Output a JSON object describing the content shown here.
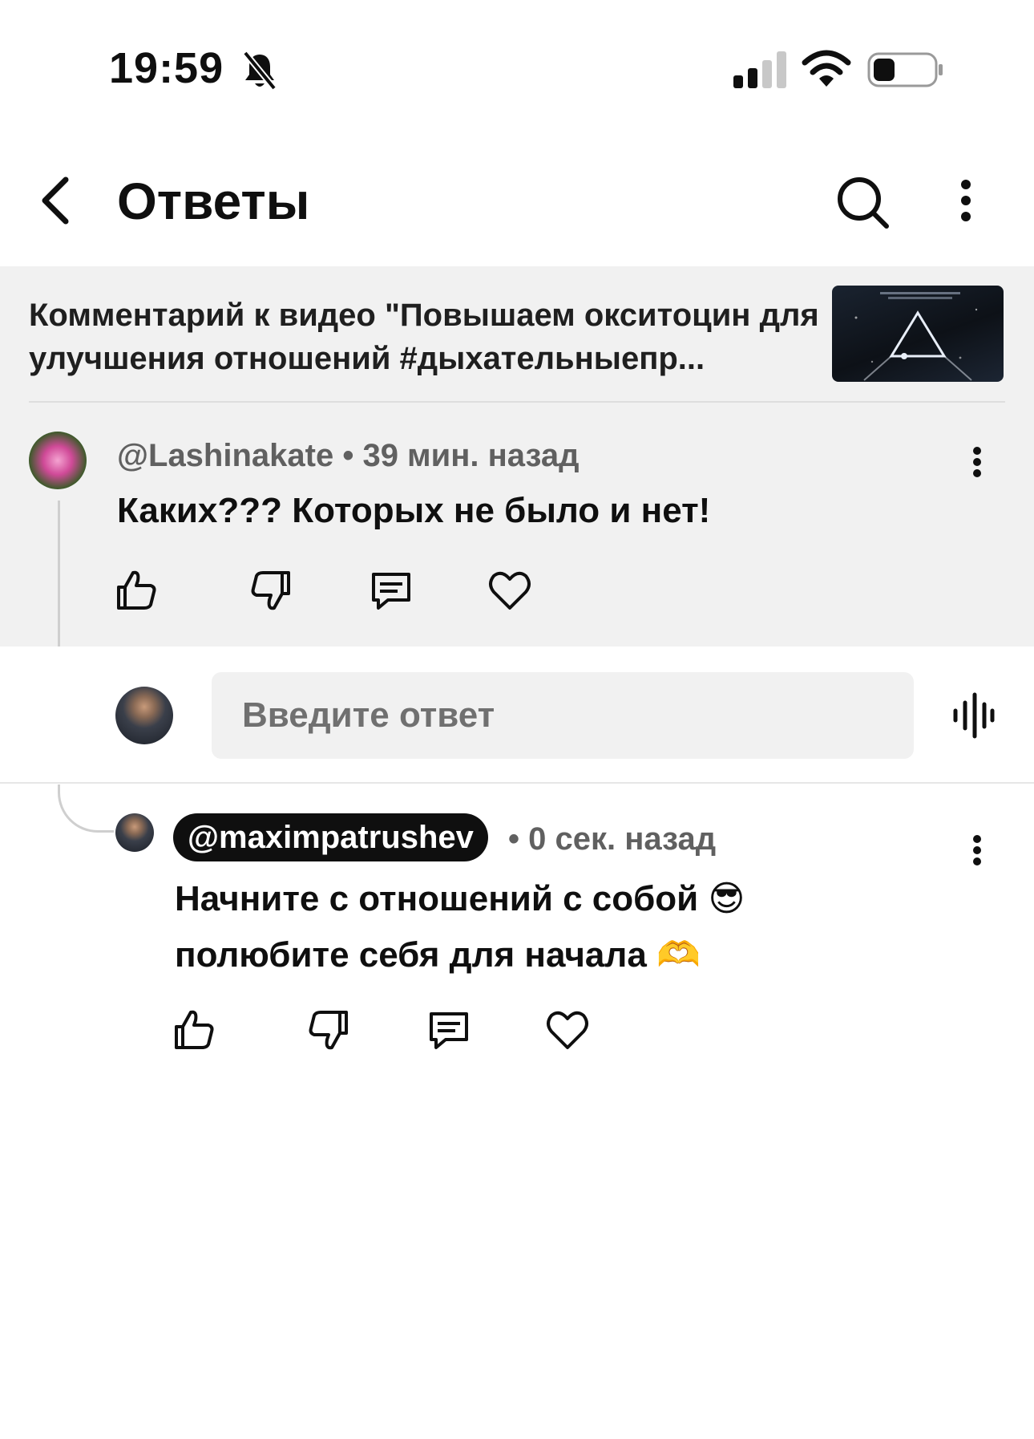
{
  "status_bar": {
    "time": "19:59",
    "icons": [
      "bell-off-icon",
      "signal-icon",
      "wifi-icon",
      "battery-icon"
    ]
  },
  "header": {
    "title": "Ответы",
    "back_icon": "back-arrow-icon",
    "search_icon": "search-icon",
    "more_icon": "more-vertical-icon"
  },
  "video_ref": {
    "text": "Комментарий к видео \"Повышаем окситоцин для улучшения отношений #дыхательныепр..."
  },
  "parent_comment": {
    "author": "@Lashinakate",
    "time": "39 мин. назад",
    "separator": " • ",
    "text": "Каких??? Которых не было и нет!",
    "actions": [
      "like-icon",
      "dislike-icon",
      "reply-icon",
      "heart-icon"
    ]
  },
  "reply_input": {
    "placeholder": "Введите ответ",
    "voice_icon": "voice-wave-icon"
  },
  "my_reply": {
    "author": "@maximpatrushev",
    "time": "0 сек. назад",
    "separator": "• ",
    "line1": "Начните с отношений с собой 😎",
    "line2": "полюбите себя для начала 🫶",
    "actions": [
      "like-icon",
      "dislike-icon",
      "reply-icon",
      "heart-icon"
    ]
  },
  "colors": {
    "background": "#ffffff",
    "grey_area": "#f1f1f1",
    "text": "#0f0f0f",
    "meta": "#606060"
  }
}
